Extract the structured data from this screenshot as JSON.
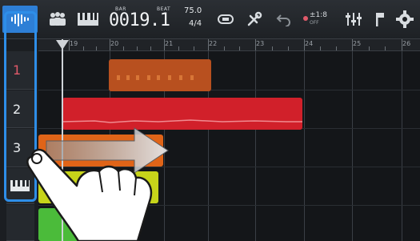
{
  "toolbar": {
    "icons": [
      "waveform-icon",
      "people-icon",
      "keyboard-icon",
      "loop-icon",
      "tools-icon",
      "undo-icon",
      "scale-icon",
      "faders-icon",
      "flag-icon",
      "gear-icon"
    ],
    "counter": {
      "bar_label": "BAR",
      "beat_label": "BEAT",
      "value": "0019.1"
    },
    "tempo": {
      "bpm": "75.0",
      "time_signature": "4/4"
    },
    "scale": {
      "top": "±1:8",
      "bottom": "OFF"
    }
  },
  "ruler": {
    "markers": [
      "19",
      "20",
      "21",
      "22",
      "23",
      "24",
      "25",
      "26"
    ]
  },
  "tracks": [
    {
      "label": "1",
      "color": "#b8501f"
    },
    {
      "label": "2",
      "color": "#d1202a"
    },
    {
      "label": "3",
      "color": "#e06418"
    },
    {
      "label": "",
      "icon": "piano-keyboard-icon",
      "color": "#c7d41a"
    },
    {
      "label": "",
      "color": "#4bbb3a"
    }
  ],
  "overlay": {
    "drag_arrow_icon": "right-arrow-icon",
    "hand_icon": "hand-pointer-icon"
  }
}
